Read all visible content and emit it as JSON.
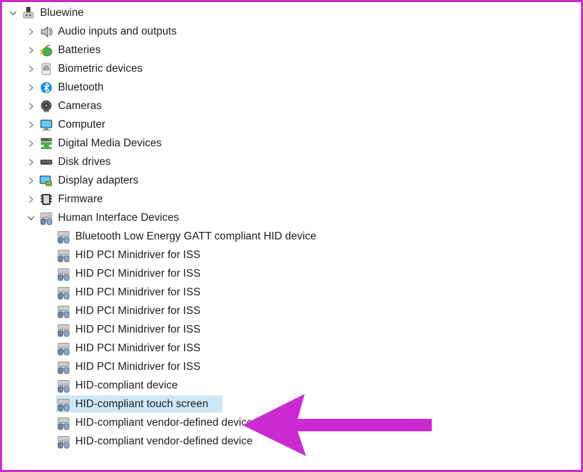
{
  "window": {
    "title": "Device Manager device tree",
    "background_color": "#ffffff",
    "border_color": "#cc2ad1",
    "selection_color": "#cde8f7",
    "text_color": "#1b1b1b",
    "annotation_arrow_color": "#cc2ad1"
  },
  "tree": {
    "root": {
      "label": "Bluewine",
      "icon": "computer-tower-icon",
      "expanded": true,
      "level": 0
    },
    "items": [
      {
        "label": "Audio inputs and outputs",
        "icon": "speaker-icon",
        "level": 1,
        "expanded": false,
        "has_children": true,
        "selected": false
      },
      {
        "label": "Batteries",
        "icon": "battery-icon",
        "level": 1,
        "expanded": false,
        "has_children": true,
        "selected": false
      },
      {
        "label": "Biometric devices",
        "icon": "fingerprint-scanner-icon",
        "level": 1,
        "expanded": false,
        "has_children": true,
        "selected": false
      },
      {
        "label": "Bluetooth",
        "icon": "bluetooth-icon",
        "level": 1,
        "expanded": false,
        "has_children": true,
        "selected": false
      },
      {
        "label": "Cameras",
        "icon": "camera-icon",
        "level": 1,
        "expanded": false,
        "has_children": true,
        "selected": false
      },
      {
        "label": "Computer",
        "icon": "monitor-icon",
        "level": 1,
        "expanded": false,
        "has_children": true,
        "selected": false
      },
      {
        "label": "Digital Media Devices",
        "icon": "media-device-icon",
        "level": 1,
        "expanded": false,
        "has_children": true,
        "selected": false
      },
      {
        "label": "Disk drives",
        "icon": "disk-drive-icon",
        "level": 1,
        "expanded": false,
        "has_children": true,
        "selected": false
      },
      {
        "label": "Display adapters",
        "icon": "display-adapter-icon",
        "level": 1,
        "expanded": false,
        "has_children": true,
        "selected": false
      },
      {
        "label": "Firmware",
        "icon": "firmware-chip-icon",
        "level": 1,
        "expanded": false,
        "has_children": true,
        "selected": false
      },
      {
        "label": "Human Interface Devices",
        "icon": "hid-keyboard-mouse-icon",
        "level": 1,
        "expanded": true,
        "has_children": true,
        "selected": false
      },
      {
        "label": "Bluetooth Low Energy GATT compliant HID device",
        "icon": "hid-keyboard-mouse-icon",
        "level": 2,
        "expanded": false,
        "has_children": false,
        "selected": false
      },
      {
        "label": "HID PCI Minidriver for ISS",
        "icon": "hid-keyboard-mouse-icon",
        "level": 2,
        "expanded": false,
        "has_children": false,
        "selected": false
      },
      {
        "label": "HID PCI Minidriver for ISS",
        "icon": "hid-keyboard-mouse-icon",
        "level": 2,
        "expanded": false,
        "has_children": false,
        "selected": false
      },
      {
        "label": "HID PCI Minidriver for ISS",
        "icon": "hid-keyboard-mouse-icon",
        "level": 2,
        "expanded": false,
        "has_children": false,
        "selected": false
      },
      {
        "label": "HID PCI Minidriver for ISS",
        "icon": "hid-keyboard-mouse-icon",
        "level": 2,
        "expanded": false,
        "has_children": false,
        "selected": false
      },
      {
        "label": "HID PCI Minidriver for ISS",
        "icon": "hid-keyboard-mouse-icon",
        "level": 2,
        "expanded": false,
        "has_children": false,
        "selected": false
      },
      {
        "label": "HID PCI Minidriver for ISS",
        "icon": "hid-keyboard-mouse-icon",
        "level": 2,
        "expanded": false,
        "has_children": false,
        "selected": false
      },
      {
        "label": "HID PCI Minidriver for ISS",
        "icon": "hid-keyboard-mouse-icon",
        "level": 2,
        "expanded": false,
        "has_children": false,
        "selected": false
      },
      {
        "label": "HID-compliant device",
        "icon": "hid-keyboard-mouse-icon",
        "level": 2,
        "expanded": false,
        "has_children": false,
        "selected": false
      },
      {
        "label": "HID-compliant touch screen",
        "icon": "hid-keyboard-mouse-icon",
        "level": 2,
        "expanded": false,
        "has_children": false,
        "selected": true
      },
      {
        "label": "HID-compliant vendor-defined device",
        "icon": "hid-keyboard-mouse-icon",
        "level": 2,
        "expanded": false,
        "has_children": false,
        "selected": false
      },
      {
        "label": "HID-compliant vendor-defined device",
        "icon": "hid-keyboard-mouse-icon",
        "level": 2,
        "expanded": false,
        "has_children": false,
        "selected": false
      }
    ]
  },
  "annotation": {
    "arrow": {
      "icon": "left-pointing-arrow-annotation",
      "direction": "left",
      "points_at": "HID-compliant touch screen"
    }
  }
}
